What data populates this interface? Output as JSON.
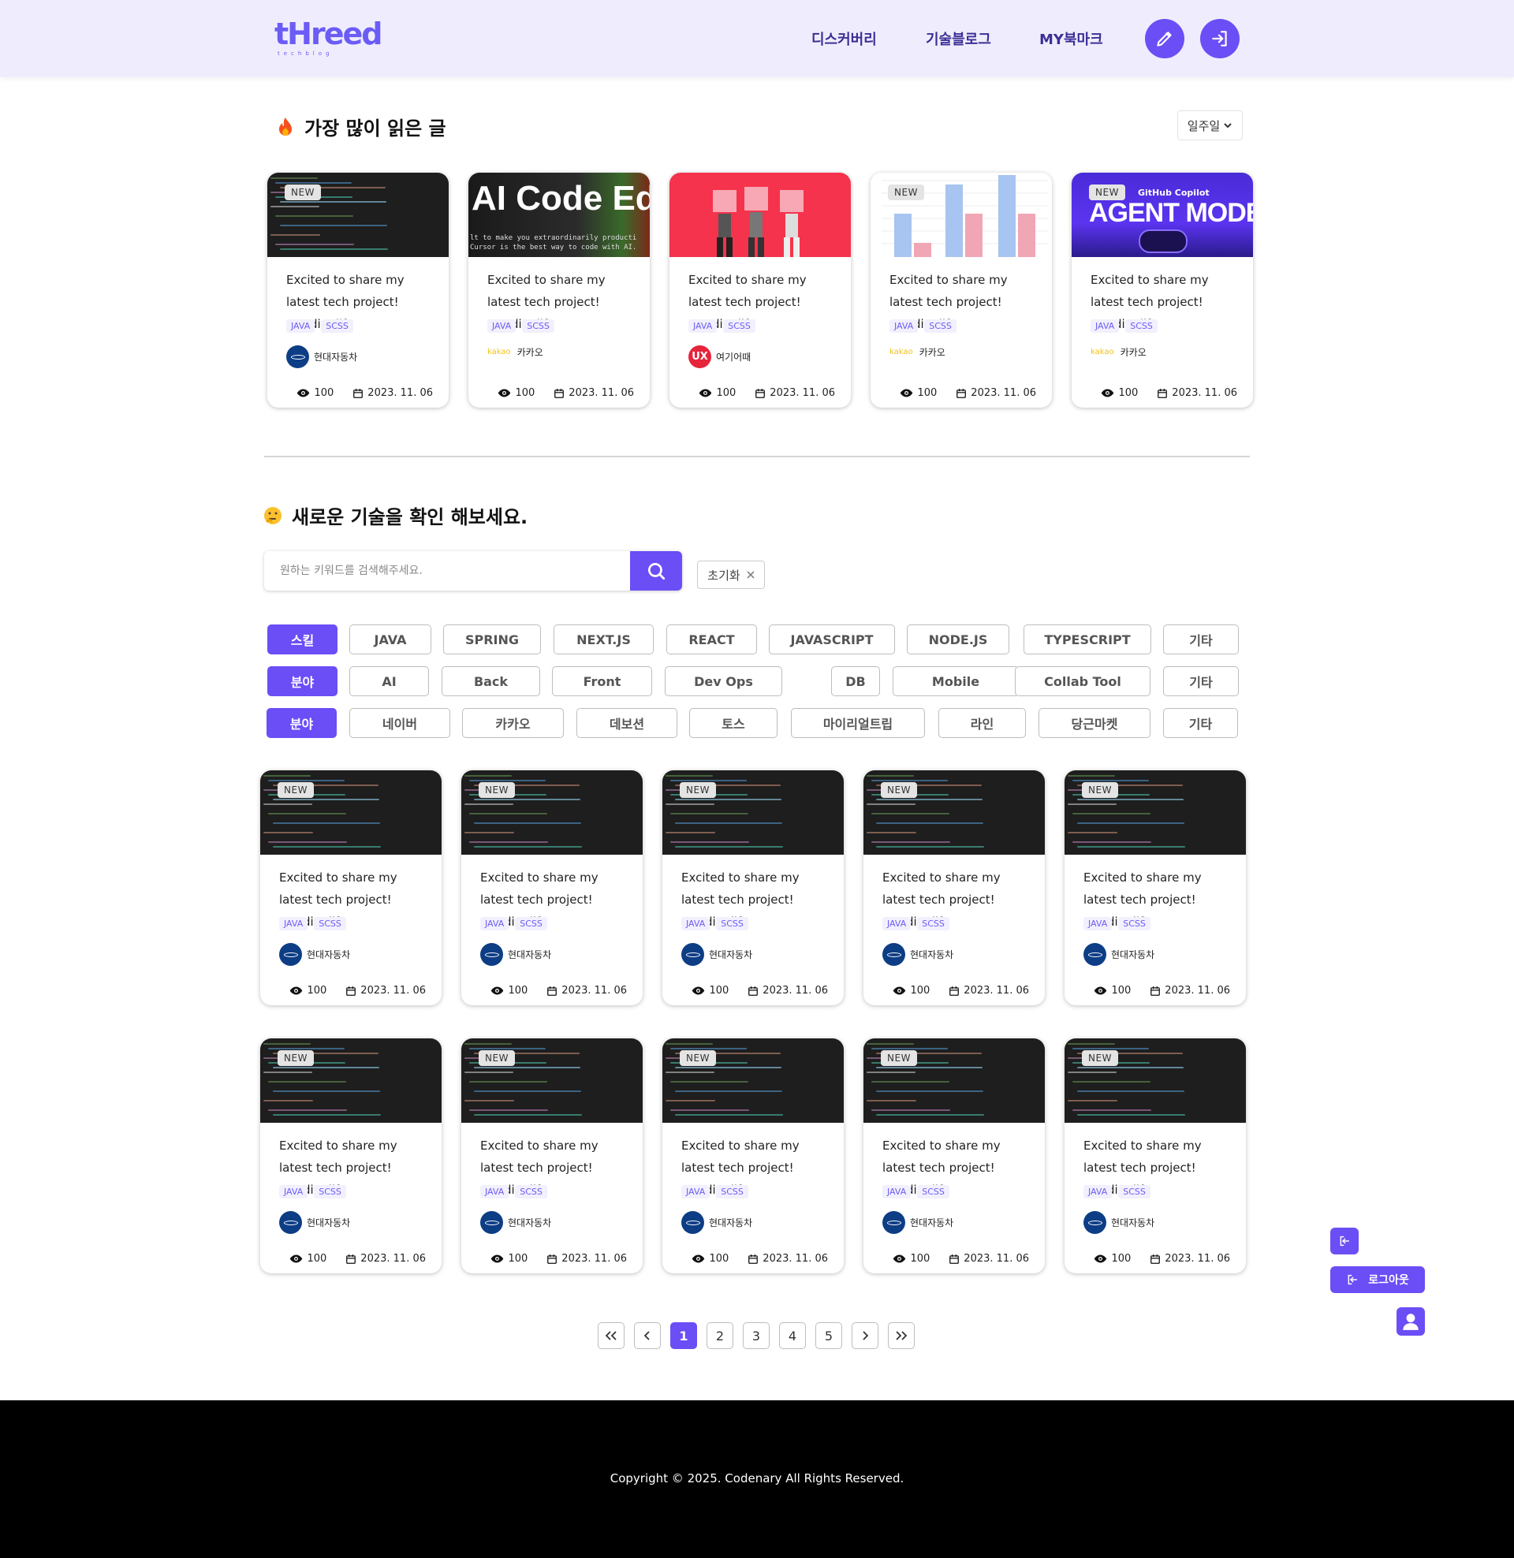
{
  "header": {
    "logo_text": "tHreed",
    "logo_sub": "techblog",
    "nav": [
      "디스커버리",
      "기술블로그",
      "MY북마크"
    ]
  },
  "popular": {
    "title": "가장 많이 읽은 글",
    "period": "일주일",
    "thumb_texts": {
      "ai_code": "AI Code Ed",
      "ai_code_sub1": "lt to make you extraordinarily producti",
      "ai_code_sub2": "Cursor is the best way to code with AI.",
      "copilot_brand": "GitHub Copilot",
      "agent_mode": "AGENT MODE"
    },
    "cards": [
      {
        "thumb": "code",
        "new": "NEW",
        "title": "Excited to share my latest tech project! #codinglife",
        "tags": [
          "JAVA",
          "SCSS"
        ],
        "company": "현대자동차",
        "logo": "hyundai",
        "views": "100",
        "date": "2023. 11. 06"
      },
      {
        "thumb": "ai",
        "new": "",
        "title": "Excited to share my latest tech project! #codinglife",
        "tags": [
          "JAVA",
          "SCSS"
        ],
        "company": "카카오",
        "logo": "kakao",
        "views": "100",
        "date": "2023. 11. 06"
      },
      {
        "thumb": "puzzle",
        "new": "",
        "title": "Excited to share my latest tech project! #codinglife",
        "tags": [
          "JAVA",
          "SCSS"
        ],
        "company": "여기어때",
        "logo": "ux",
        "views": "100",
        "date": "2023. 11. 06"
      },
      {
        "thumb": "chart",
        "new": "NEW",
        "title": "Excited to share my latest tech project! #codinglife",
        "tags": [
          "JAVA",
          "SCSS"
        ],
        "company": "카카오",
        "logo": "kakao",
        "views": "100",
        "date": "2023. 11. 06"
      },
      {
        "thumb": "copilot",
        "new": "NEW",
        "title": "Excited to share my latest tech project! #codinglife",
        "tags": [
          "JAVA",
          "SCSS"
        ],
        "company": "카카오",
        "logo": "kakao",
        "views": "100",
        "date": "2023. 11. 06"
      }
    ]
  },
  "explore": {
    "title": "새로운 기술을 확인 해보세요.",
    "search_placeholder": "원하는 키워드를 검색해주세요.",
    "reset_label": "초기화",
    "filters": [
      {
        "label": "스킬",
        "chips": [
          "JAVA",
          "SPRING",
          "NEXT.JS",
          "REACT",
          "JAVASCRIPT",
          "NODE.JS",
          "TYPESCRIPT",
          "기타"
        ]
      },
      {
        "label": "분야",
        "chips": [
          "AI",
          "Back",
          "Front",
          "Dev Ops",
          "DB",
          "Mobile",
          "Collab Tool",
          "기타"
        ]
      },
      {
        "label": "분야",
        "chips": [
          "네이버",
          "카카오",
          "데보션",
          "토스",
          "마이리얼트립",
          "라인",
          "당근마켓",
          "기타"
        ]
      }
    ],
    "card": {
      "new": "NEW",
      "title": "Excited to share my latest tech project! #codinglife",
      "tags": [
        "JAVA",
        "SCSS"
      ],
      "company": "현대자동차",
      "views": "100",
      "date": "2023. 11. 06"
    },
    "card_count": 10
  },
  "pagination": {
    "pages": [
      "1",
      "2",
      "3",
      "4",
      "5"
    ],
    "current": "1"
  },
  "floating": {
    "logout_label": "로그아웃"
  },
  "footer": {
    "copyright": "Copyright © 2025. Codenary All Rights Reserved."
  },
  "colors": {
    "accent": "#6b4ef6",
    "nav_text": "#3b2f95",
    "header_bg": "#efedfd"
  },
  "icons": [
    "pencil-icon",
    "login-icon",
    "fire-icon",
    "thinking-face-icon",
    "chevron-down-icon",
    "search-icon",
    "close-icon",
    "eye-icon",
    "calendar-icon",
    "double-chevron-left-icon",
    "chevron-left-icon",
    "chevron-right-icon",
    "double-chevron-right-icon",
    "logout-icon",
    "user-icon"
  ]
}
